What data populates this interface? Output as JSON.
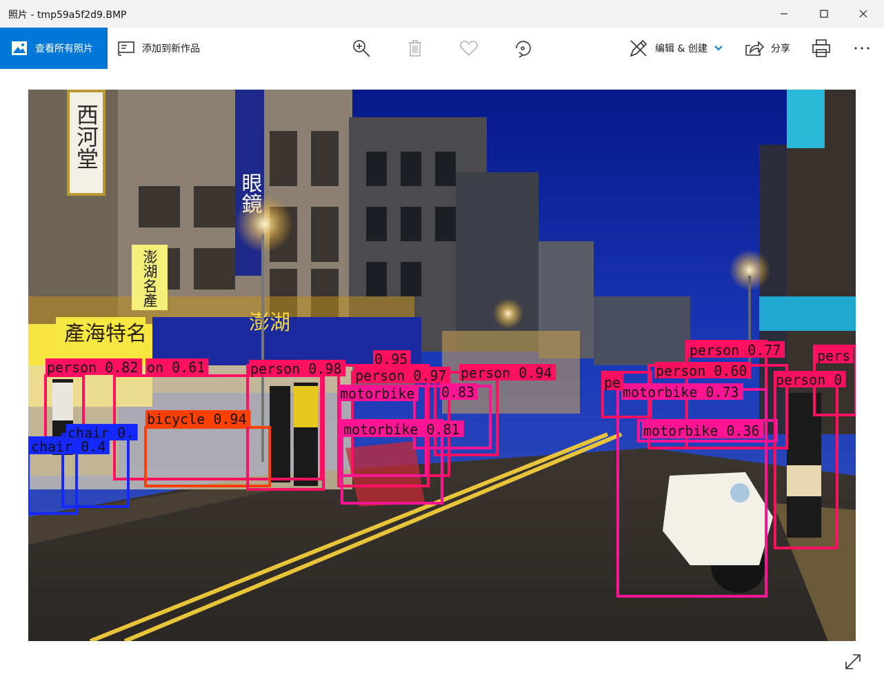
{
  "window": {
    "title": "照片 - tmp59a5f2d9.BMP",
    "controls": [
      "minimize",
      "maximize",
      "close"
    ]
  },
  "toolbar": {
    "view_all_label": "查看所有照片",
    "add_to_creation_label": "添加到新作品",
    "edit_create_label": "编辑 & 创建",
    "share_label": "分享",
    "icons": [
      "photos-icon",
      "add-to-creation-icon",
      "zoom-in-icon",
      "delete-icon",
      "favorite-icon",
      "rotate-icon",
      "edit-create-icon",
      "chevron-down-icon",
      "share-icon",
      "print-icon",
      "more-icon"
    ],
    "accent_color": "#0078d7"
  },
  "photo": {
    "detections": [
      {
        "label": "person 0.82",
        "class": "person",
        "color": "#ff1060"
      },
      {
        "label": "on 0.61",
        "class": "person",
        "color": "#ff1060"
      },
      {
        "label": "bicycle 0.94",
        "class": "bicycle",
        "color": "#ff4000"
      },
      {
        "label": "chair 0.",
        "class": "chair",
        "color": "#1428ff"
      },
      {
        "label": "chair 0.4",
        "class": "chair",
        "color": "#1428ff"
      },
      {
        "label": "person 0.98",
        "class": "person",
        "color": "#ff1060"
      },
      {
        "label": "0.95",
        "class": "person",
        "color": "#ff1060"
      },
      {
        "label": "person 0.97",
        "class": "person",
        "color": "#ff1060"
      },
      {
        "label": "person 0.94",
        "class": "person",
        "color": "#ff1060"
      },
      {
        "label": "motorbike",
        "class": "motorbike",
        "color": "#ff1493"
      },
      {
        "label": "0.83",
        "class": "motorbike",
        "color": "#ff1493"
      },
      {
        "label": "motorbike 0.81",
        "class": "motorbike",
        "color": "#ff1493"
      },
      {
        "label": "person 0.77",
        "class": "person",
        "color": "#ff1060"
      },
      {
        "label": "person 0.60",
        "class": "person",
        "color": "#ff1060"
      },
      {
        "label": "pers",
        "class": "person",
        "color": "#ff1060"
      },
      {
        "label": "motorbike 0.73",
        "class": "motorbike",
        "color": "#ff1493"
      },
      {
        "label": "person 0",
        "class": "person",
        "color": "#ff1060"
      },
      {
        "label": "motorbike 0.36",
        "class": "motorbike",
        "color": "#ff1493"
      },
      {
        "label": "pe",
        "class": "person",
        "color": "#ff1060"
      }
    ],
    "signs": [
      {
        "text": "西河堂"
      },
      {
        "text": "澎湖名產"
      },
      {
        "text": "產海特名"
      },
      {
        "text": "澎湖"
      },
      {
        "text": "眼鏡"
      }
    ]
  }
}
